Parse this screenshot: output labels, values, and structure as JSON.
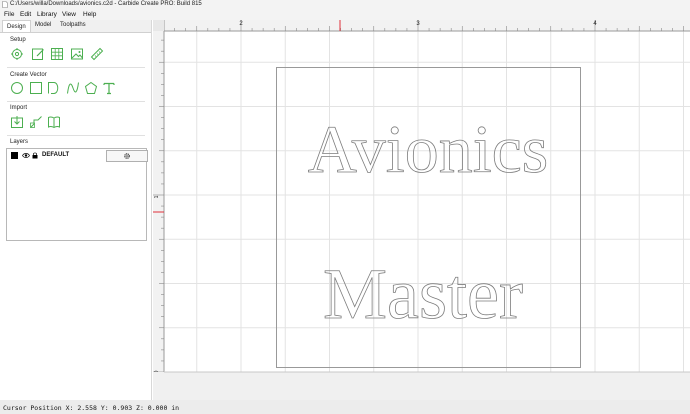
{
  "window": {
    "title": "C:/Users/willa/Downloads/avionics.c2d - Carbide Create PRO: Build 815"
  },
  "menu": {
    "file": "File",
    "edit": "Edit",
    "library": "Library",
    "view": "View",
    "help": "Help"
  },
  "tabs": {
    "design": "Design",
    "model": "Model",
    "toolpaths": "Toolpaths"
  },
  "sections": {
    "setup": "Setup",
    "create_vector": "Create Vector",
    "import": "Import",
    "layers": "Layers"
  },
  "icons": {
    "setup": [
      "job-setup-icon",
      "document-edit-icon",
      "grid-icon",
      "image-icon",
      "measure-icon"
    ],
    "create_vector": [
      "circle-icon",
      "rectangle-icon",
      "polyline-icon",
      "curve-icon",
      "polygon-icon",
      "text-icon"
    ],
    "import": [
      "import-icon",
      "trace-icon",
      "book-icon"
    ]
  },
  "layers": [
    {
      "name": "DEFAULT",
      "color": "#000000"
    }
  ],
  "ruler": {
    "x_labels": [
      "2",
      "3",
      "4"
    ],
    "y_labels": [
      "1",
      "0"
    ]
  },
  "canvas_text": {
    "line1": "Avionics",
    "line2": "Master"
  },
  "status": {
    "cursor": "Cursor Position X: 2.558 Y: 0.903 Z: 0.000 in"
  },
  "colors": {
    "accent_icon": "#4caf50",
    "cursor_marker": "#e0303a",
    "stock_outline": "#999999"
  }
}
